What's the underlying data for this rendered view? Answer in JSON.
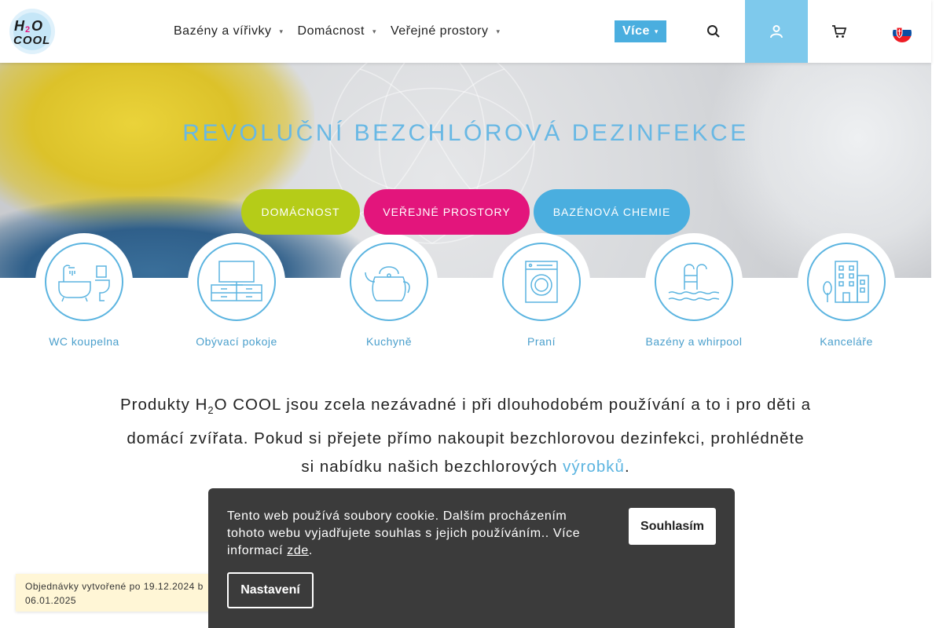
{
  "header": {
    "logo_text_top": "H2O",
    "logo_text_bottom": "COOL",
    "nav": [
      {
        "label": "Bazény a vířivky"
      },
      {
        "label": "Domácnost"
      },
      {
        "label": "Veřejné prostory"
      }
    ],
    "more_label": "Více"
  },
  "hero": {
    "title": "REVOLUČNÍ BEZCHLÓROVÁ DEZINFEKCE",
    "buttons": {
      "home": "DOMÁCNOST",
      "public": "VEŘEJNÉ PROSTORY",
      "pool": "BAZÉNOVÁ CHEMIE"
    }
  },
  "rooms": [
    {
      "label": "WC koupelna"
    },
    {
      "label": "Obývací pokoje"
    },
    {
      "label": "Kuchyně"
    },
    {
      "label": "Praní"
    },
    {
      "label": "Bazény a whirpool"
    },
    {
      "label": "Kanceláře"
    }
  ],
  "intro": {
    "part1": "Produkty H",
    "sub": "2",
    "part2": "O COOL jsou zcela nezávadné i při dlouhodobém používání a to i pro děti a domácí zvířata. Pokud si přejete přímo nakoupit bezchlorovou dezinfekci, prohlédněte si nabídku našich bezchlorových ",
    "link": "výrobků",
    "part3": "."
  },
  "notice": {
    "text": "Objednávky vytvořené po 19.12.2024 b 06.01.2025"
  },
  "cookie": {
    "text": "Tento web používá soubory cookie. Dalším procházením tohoto webu vyjadřujete souhlas s jejich používáním.. Více informací ",
    "link": "zde",
    "after": ".",
    "accept": "Souhlasím",
    "settings": "Nastavení"
  },
  "colors": {
    "accent_blue": "#4aaedf",
    "home_green": "#b5cc18",
    "public_pink": "#e3157c"
  }
}
